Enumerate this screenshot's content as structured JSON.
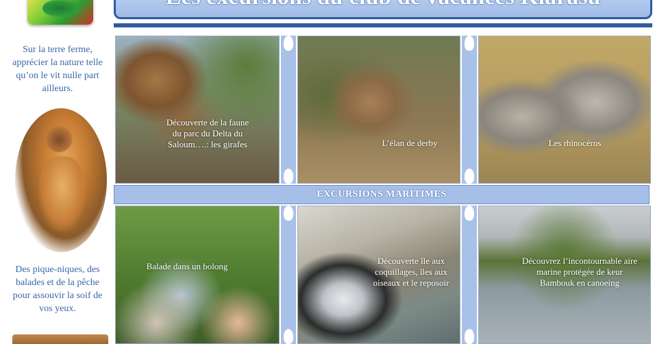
{
  "header": {
    "title": "Les excursions  du club  de vacances Kiarasu"
  },
  "sidebar": {
    "text_top": "Sur la terre ferme, apprécier la nature telle qu’on le vit nulle part ailleurs.",
    "text_bottom": "Des pique-niques, des balades et de la pêche pour assouvir la soif de vos yeux."
  },
  "banner": {
    "label": "EXCURSIONS MARITIMES"
  },
  "captions": {
    "giraffes": "Découverte de  la faune du parc du Delta du Saloum….: les girafes",
    "eland": "L’élan de derby",
    "rhinos": "Les rhinocéros",
    "bolong": "Balade dans un bolong",
    "shells": "Découverte île aux coquillages, îles aux oiseaux et le reposoir",
    "bambouk": "Découvrez l’incontournable aire marine protégée de keur Bambouk en canoeing"
  },
  "colors": {
    "accent": "#2f5aa0",
    "banner": "#a6bfe8",
    "side_text": "#3a66a8"
  }
}
